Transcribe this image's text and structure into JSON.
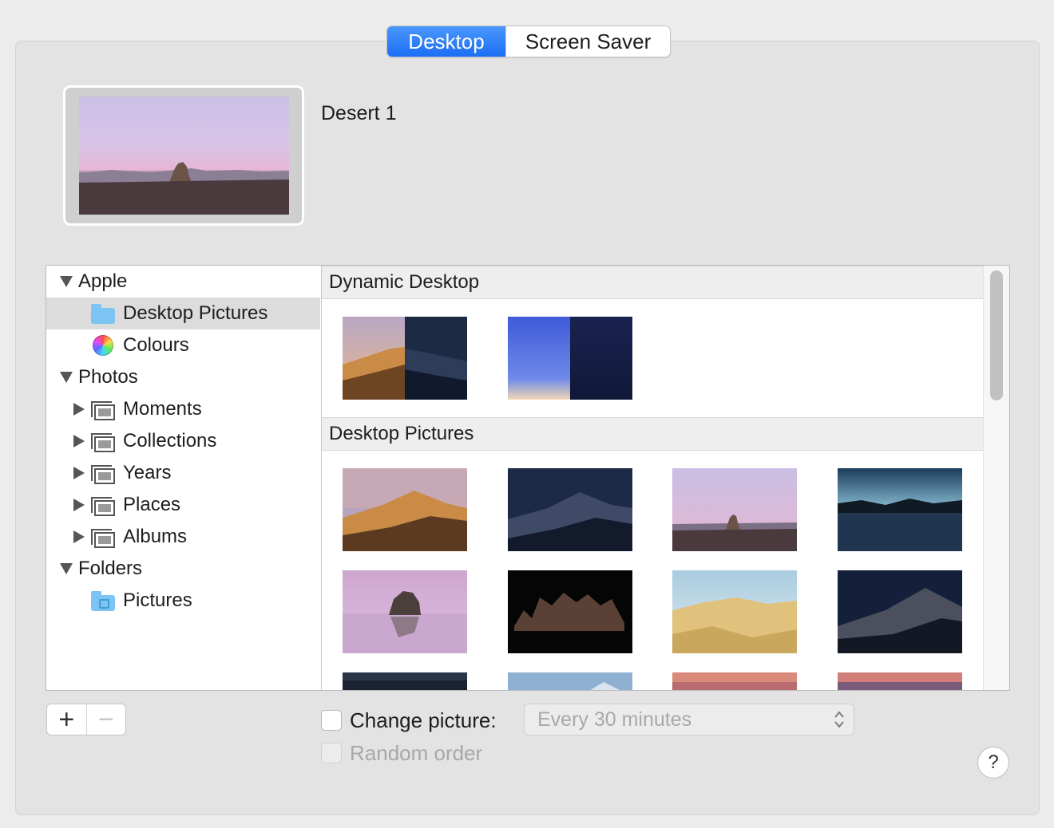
{
  "tabs": [
    {
      "label": "Desktop",
      "active": true
    },
    {
      "label": "Screen Saver",
      "active": false
    }
  ],
  "preview": {
    "title": "Desert 1"
  },
  "sidebar": {
    "items": [
      {
        "label": "Apple",
        "icon": "disclosure-triangle-down"
      },
      {
        "label": "Desktop Pictures",
        "icon": "folder-icon",
        "selected": true
      },
      {
        "label": "Colours",
        "icon": "colour-wheel-icon"
      },
      {
        "label": "Photos",
        "icon": "disclosure-triangle-down"
      },
      {
        "label": "Moments",
        "icon": "photo-stack-icon"
      },
      {
        "label": "Collections",
        "icon": "photo-stack-icon"
      },
      {
        "label": "Years",
        "icon": "photo-stack-icon"
      },
      {
        "label": "Places",
        "icon": "photo-stack-icon"
      },
      {
        "label": "Albums",
        "icon": "photo-stack-icon"
      },
      {
        "label": "Folders",
        "icon": "disclosure-triangle-down"
      },
      {
        "label": "Pictures",
        "icon": "pictures-folder-icon"
      }
    ]
  },
  "grid": {
    "sections": [
      {
        "title": "Dynamic Desktop"
      },
      {
        "title": "Desktop Pictures"
      }
    ]
  },
  "controls": {
    "add_label": "+",
    "remove_label": "−",
    "change_picture_label": "Change picture:",
    "change_picture_checked": false,
    "interval_value": "Every 30 minutes",
    "random_order_label": "Random order",
    "random_order_checked": false,
    "help_label": "?"
  },
  "colors": {
    "accent": "#1c6ef5",
    "selection": "#dcdcdc",
    "panel": "#e3e3e3"
  }
}
